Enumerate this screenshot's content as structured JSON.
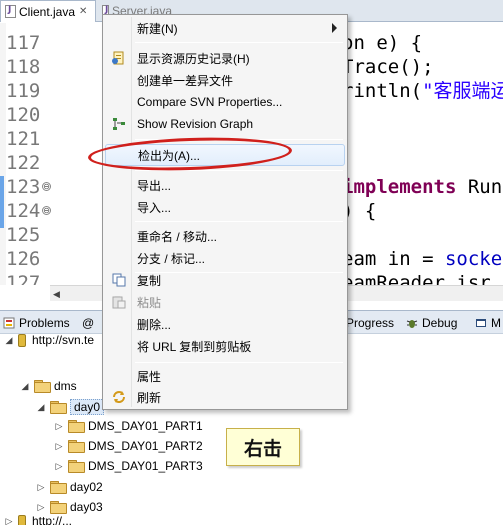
{
  "editor": {
    "tabs": [
      {
        "label": "Client.java",
        "close": "✕"
      },
      {
        "label": "Server.java"
      }
    ],
    "line_numbers": [
      "117",
      "118",
      "119",
      "120",
      "121",
      "122",
      "123",
      "124",
      "125",
      "126",
      "127"
    ],
    "code_lines": [
      {
        "parts": [
          {
            "t": "on e) {",
            "c": ""
          }
        ]
      },
      {
        "parts": [
          {
            "t": "Trace();",
            "c": ""
          }
        ]
      },
      {
        "parts": [
          {
            "t": "rintln(",
            "c": ""
          },
          {
            "t": "\"客服端运行",
            "c": "str"
          }
        ]
      },
      {
        "parts": [
          {
            "t": "",
            "c": ""
          }
        ]
      },
      {
        "parts": [
          {
            "t": "",
            "c": ""
          }
        ]
      },
      {
        "parts": [
          {
            "t": "",
            "c": ""
          }
        ]
      },
      {
        "parts": [
          {
            "t": "implements",
            "c": "kw"
          },
          {
            "t": " Run",
            "c": ""
          }
        ]
      },
      {
        "parts": [
          {
            "t": ") {",
            "c": ""
          }
        ]
      },
      {
        "parts": [
          {
            "t": "",
            "c": ""
          }
        ]
      },
      {
        "parts": [
          {
            "t": "eam ",
            "c": ""
          },
          {
            "t": "in",
            "c": ""
          },
          {
            "t": " = ",
            "c": ""
          },
          {
            "t": "socke",
            "c": "fld"
          }
        ]
      },
      {
        "parts": [
          {
            "t": "eamReader isr",
            "c": ""
          }
        ]
      }
    ]
  },
  "views": {
    "tabs": [
      {
        "label": "Problems",
        "icon": "problems-icon"
      },
      {
        "label": "@",
        "icon": ""
      },
      {
        "label": "Progress",
        "icon": "progress-icon"
      },
      {
        "label": "Debug",
        "icon": "debug-icon"
      },
      {
        "label": "M",
        "icon": "console-icon"
      }
    ]
  },
  "tree": {
    "root_label": "http://svn.te",
    "items": [
      {
        "label": "dms",
        "twisty": "◢"
      },
      {
        "label": "day0",
        "twisty": "◢"
      },
      {
        "label": "DMS_DAY01_PART1",
        "twisty": "▷"
      },
      {
        "label": "DMS_DAY01_PART2",
        "twisty": "▷"
      },
      {
        "label": "DMS_DAY01_PART3",
        "twisty": "▷"
      },
      {
        "label": "day02",
        "twisty": "▷"
      },
      {
        "label": "day03",
        "twisty": "▷"
      }
    ],
    "next_root": "http://..."
  },
  "context_menu": {
    "items": [
      {
        "label": "新建(N)",
        "submenu": true
      },
      {
        "label": "显示资源历史记录(H)",
        "icon": "history-icon"
      },
      {
        "label": "创建单一差异文件"
      },
      {
        "label": "Compare SVN Properties..."
      },
      {
        "label": "Show Revision Graph",
        "icon": "revision-graph-icon"
      },
      {
        "label": "检出为(A)...",
        "highlighted": true
      },
      {
        "label": "导出..."
      },
      {
        "label": "导入..."
      },
      {
        "label": "重命名 / 移动..."
      },
      {
        "label": "分支 / 标记..."
      },
      {
        "label": "复制",
        "icon": "copy-icon"
      },
      {
        "label": "粘贴",
        "icon": "paste-icon",
        "disabled": true
      },
      {
        "label": "删除..."
      },
      {
        "label": "将 URL 复制到剪贴板"
      },
      {
        "label": "属性"
      },
      {
        "label": "刷新",
        "icon": "refresh-icon"
      }
    ]
  },
  "annotation": {
    "text": "右击"
  },
  "colors": {
    "highlight_ring": "#d0201c",
    "selection": "#dce9f8"
  }
}
